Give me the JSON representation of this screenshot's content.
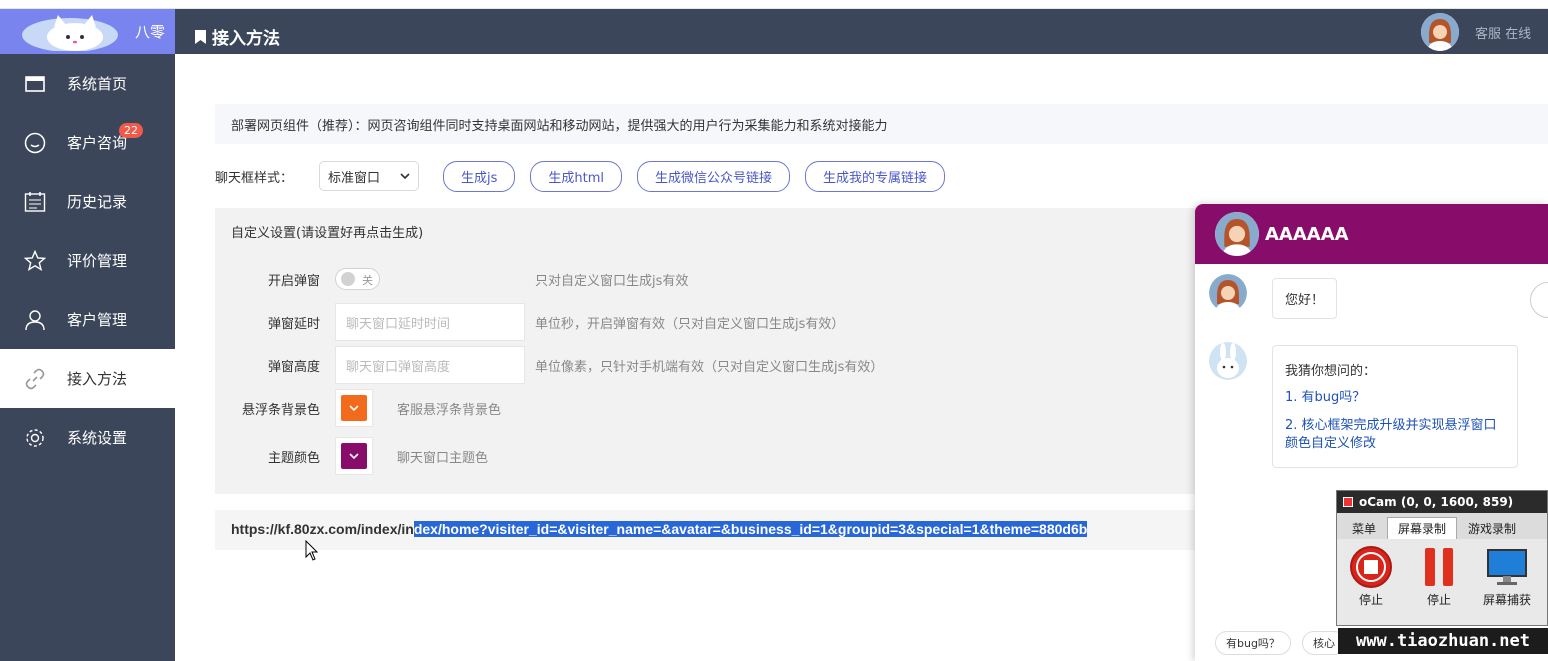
{
  "app": {
    "brand_name": "八零",
    "page_title": "接入方法",
    "agent_status": "客服 在线"
  },
  "sidebar": {
    "items": [
      {
        "label": "系统首页",
        "icon": "window-icon"
      },
      {
        "label": "客户咨询",
        "icon": "smile-icon",
        "badge": "22"
      },
      {
        "label": "历史记录",
        "icon": "calendar-icon"
      },
      {
        "label": "评价管理",
        "icon": "star-icon"
      },
      {
        "label": "客户管理",
        "icon": "user-icon"
      },
      {
        "label": "接入方法",
        "icon": "link-icon",
        "active": true
      },
      {
        "label": "系统设置",
        "icon": "gear-icon"
      }
    ]
  },
  "main": {
    "notice": "部署网页组件（推荐）：网页咨询组件同时支持桌面网站和移动网站，提供强大的用户行为采集能力和系统对接能力",
    "style_label": "聊天框样式：",
    "style_select_value": "标准窗口",
    "buttons": [
      "生成js",
      "生成html",
      "生成微信公众号链接",
      "生成我的专属链接"
    ],
    "custom": {
      "title": "自定义设置(请设置好再点击生成)",
      "popup_label": "开启弹窗",
      "popup_toggle_text": "关",
      "popup_hint": "只对自定义窗口生成js有效",
      "delay_label": "弹窗延时",
      "delay_placeholder": "聊天窗口延时时间",
      "delay_hint": "单位秒，开启弹窗有效（只对自定义窗口生成js有效）",
      "height_label": "弹窗高度",
      "height_placeholder": "聊天窗口弹窗高度",
      "height_hint": "单位像素，只针对手机端有效（只对自定义窗口生成js有效）",
      "float_bg_label": "悬浮条背景色",
      "float_bg_hint": "客服悬浮条背景色",
      "float_bg_color": "#f26b1d",
      "theme_label": "主题颜色",
      "theme_hint": "聊天窗口主题色",
      "theme_color": "#880d6b"
    },
    "url_prefix": "https://kf.80zx.com/index/in",
    "url_selected": "dex/home?visiter_id=&visiter_name=&avatar=&business_id=1&groupid=3&special=1&theme=880d6b"
  },
  "chat": {
    "name": "AAAAAA",
    "greeting": "您好！",
    "guess_title": "我猜你想问的：",
    "questions": [
      "1. 有bug吗？",
      "2. 核心框架完成升级并实现悬浮窗口颜色自定义修改"
    ],
    "quick_replies": [
      "有bug吗？",
      "核心"
    ]
  },
  "ocam": {
    "title": "oCam (0, 0, 1600, 859)",
    "tabs": [
      "菜单",
      "屏幕录制",
      "游戏录制"
    ],
    "tools": [
      "停止",
      "停止",
      "屏幕捕获"
    ]
  },
  "watermark": "www.tiaozhuan.net",
  "colors": {
    "sidebar": "#3c465a",
    "brand": "#7a84ee",
    "theme": "#880d6b",
    "accent": "#4a57c8"
  }
}
